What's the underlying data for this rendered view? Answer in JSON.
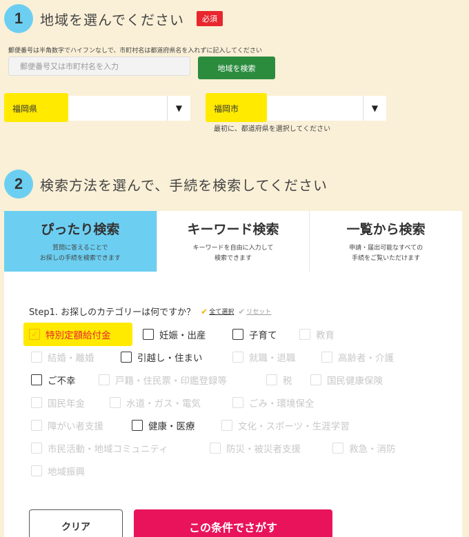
{
  "section1": {
    "number": "1",
    "title": "地域を選んでください",
    "badge": "必須",
    "postal_hint": "郵便番号は半角数字でハイフンなしで、市町村名は都道府県名を入れずに記入してください",
    "postal_placeholder": "郵便番号又は市町村名を入力",
    "search_button": "地域を検索",
    "prefecture_value": "福岡県",
    "city_value": "福岡市",
    "arrow_glyph": "▼",
    "city_hint": "最初に、都道府県を選択してください"
  },
  "section2": {
    "number": "2",
    "title": "検索方法を選んで、手続を検索してください",
    "tabs": [
      {
        "label": "ぴったり検索",
        "desc1": "質問に答えることで",
        "desc2": "お探しの手続を検索できます"
      },
      {
        "label": "キーワード検索",
        "desc1": "キーワードを自由に入力して",
        "desc2": "検索できます"
      },
      {
        "label": "一覧から検索",
        "desc1": "申請・届出可能なすべての",
        "desc2": "手続をご覧いただけます"
      }
    ],
    "step1_label": "Step1. お探しのカテゴリーは何ですか？",
    "select_all": "全て選択",
    "reset": "リセット",
    "categories": [
      "特別定額給付金",
      "妊娠・出産",
      "子育て",
      "教育",
      "結婚・離婚",
      "引越し・住まい",
      "就職・退職",
      "高齢者・介護",
      "ご不幸",
      "戸籍・住民票・印鑑登録等",
      "税",
      "国民健康保険",
      "国民年金",
      "水道・ガス・電気",
      "ごみ・環境保全",
      "障がい者支援",
      "健康・医療",
      "文化・スポーツ・生涯学習",
      "市民活動・地域コミュニティ",
      "防災・被災者支援",
      "救急・消防",
      "地域振興"
    ],
    "clear_button": "クリア",
    "submit_button": "この条件でさがす"
  },
  "colors": {
    "background": "#faf0d7",
    "step_circle": "#6ccff2",
    "required_red": "#e8262e",
    "search_green": "#2b8c3e",
    "highlight_yellow": "#ffea00",
    "submit_pink": "#e8135a"
  }
}
